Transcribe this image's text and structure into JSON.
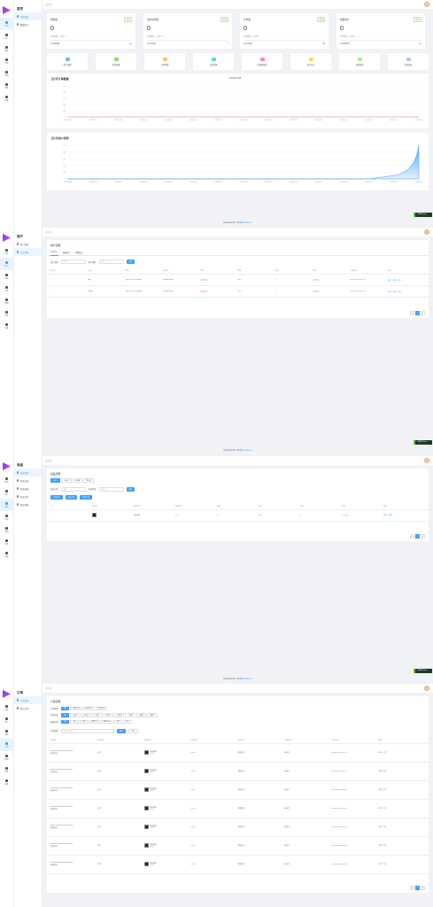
{
  "breadcrumb": "工作台",
  "user": {
    "name": "admin"
  },
  "footer": {
    "prefix": "Powered By ",
    "link": "CRMEB Java 1.0"
  },
  "badge": {
    "text": "CRMEB Java"
  },
  "nav": [
    {
      "label": "首页",
      "icon": "home-icon"
    },
    {
      "label": "用户",
      "icon": "user-icon"
    },
    {
      "label": "商品",
      "icon": "goods-icon"
    },
    {
      "label": "订单",
      "icon": "order-icon"
    },
    {
      "label": "营销",
      "icon": "marketing-icon"
    },
    {
      "label": "财务",
      "icon": "finance-icon"
    },
    {
      "label": "设置",
      "icon": "settings-icon"
    }
  ],
  "screen1": {
    "sub_title": "首页",
    "sub_items": [
      "控制面板",
      "数据统计"
    ],
    "stats": [
      {
        "title": "销售额",
        "tag": "今日",
        "value": "0",
        "sub": "昨日数据：0  本周：0",
        "foot_l": "本月销售额",
        "foot_r": "0元"
      },
      {
        "title": "用户访问量",
        "tag": "今日",
        "value": "0",
        "sub": "昨日数据：0  本周：0",
        "foot_l": "本月访问量",
        "foot_r": "0"
      },
      {
        "title": "订单量",
        "tag": "今日",
        "value": "0",
        "sub": "昨日数据：0  本周：0",
        "foot_l": "本月订单量",
        "foot_r": "0单"
      },
      {
        "title": "新增用户",
        "tag": "今日",
        "value": "0",
        "sub": "昨日数据：0  本周：0",
        "foot_l": "本月新增用户",
        "foot_r": "0人"
      }
    ],
    "quick": [
      {
        "label": "用户管理",
        "color": "#69c0ff"
      },
      {
        "label": "商品管理",
        "color": "#95de64"
      },
      {
        "label": "订单管理",
        "color": "#ffc069"
      },
      {
        "label": "分类管理",
        "color": "#5cdbd3"
      },
      {
        "label": "优惠券管理",
        "color": "#ff85c0"
      },
      {
        "label": "积分日志",
        "color": "#ffd666"
      },
      {
        "label": "提现管理",
        "color": "#b7eb8f"
      },
      {
        "label": "系统设置",
        "color": "#adc6ff"
      }
    ],
    "chart1_title": "近7天订单数据",
    "chart1_legend": "订单金额  订单数",
    "chart2_title": "近7天用户走势"
  },
  "chart_data": [
    {
      "type": "line",
      "title": "近7天订单数据",
      "x": [
        "2022-05-01",
        "2022-05-02",
        "2022-05-03",
        "2022-05-04",
        "2022-05-05",
        "2022-05-06",
        "2022-05-07",
        "2022-05-08",
        "2022-05-09",
        "2022-05-10",
        "2022-05-11",
        "2022-05-12",
        "2022-05-13",
        "2022-05-14",
        "2022-05-15"
      ],
      "series": [
        {
          "name": "订单金额",
          "values": [
            0,
            0,
            0,
            0,
            0,
            0,
            0,
            0,
            0,
            0,
            0,
            0,
            0,
            0,
            0
          ]
        }
      ],
      "yticks": [
        "1.0",
        "0.8",
        "0.6",
        "0.4",
        "0.2",
        "0"
      ],
      "ylim": [
        0,
        1
      ]
    },
    {
      "type": "area",
      "title": "近7天用户走势",
      "x": [
        "2022-05-01",
        "2022-05-02",
        "2022-05-03",
        "2022-05-04",
        "2022-05-05",
        "2022-05-06",
        "2022-05-07",
        "2022-05-08",
        "2022-05-09",
        "2022-05-10",
        "2022-05-11",
        "2022-05-12",
        "2022-05-13",
        "2022-05-14",
        "2022-05-15"
      ],
      "series": [
        {
          "name": "",
          "values": [
            0,
            0,
            0,
            0,
            0,
            0,
            0,
            0,
            0,
            0,
            0,
            0,
            0,
            0.1,
            1
          ]
        }
      ],
      "yticks": [
        "1.0",
        "0.8",
        "0.6",
        "0.4",
        "0.2",
        "0"
      ],
      "ylim": [
        0,
        1
      ]
    }
  ],
  "screen2": {
    "sub_title": "用户",
    "sub_items": [
      "用户管理",
      "会员等级"
    ],
    "panel_title": "用户管理",
    "tabs": [
      "全部用户",
      "普通用户",
      "付费会员"
    ],
    "filter_label": "用户名称",
    "filter_ph": "请输入",
    "filter_label2": "用户昵称",
    "search_btn": "搜索",
    "columns": [
      "用户ID",
      "头像",
      "昵称",
      "手机号",
      "性别",
      "余额",
      "积分",
      "状态",
      "注册时间",
      "操作"
    ],
    "rows": [
      [
        "1",
        "tpm",
        "http://127.0.0.1/avatar",
        "13800000000",
        "未知",
        "0.00",
        "0",
        "正常",
        "2022-05-12 10:22:32"
      ],
      [
        "2",
        "crmeb",
        "http://127.0.0.1/avatar",
        "13900000000",
        "未知",
        "0.00",
        "0",
        "正常",
        "2022-05-12 10:22:32"
      ]
    ],
    "actions": [
      "编辑",
      "详情",
      "更多"
    ]
  },
  "screen3": {
    "sub_title": "商品",
    "sub_items": [
      "商品管理",
      "商品分类",
      "商品规格",
      "商品评论",
      "商品参数"
    ],
    "panel_title": "商品管理",
    "tabs": [
      "出售中",
      "仓库中",
      "已售罄",
      "回收站"
    ],
    "filter_label": "商品分类",
    "filter_label2": "商品名称",
    "filter_ph": "请输入",
    "search_btn": "搜索",
    "btns": [
      "添加商品",
      "批量上架",
      "批量下架"
    ],
    "columns": [
      "ID",
      "商品图",
      "商品名称",
      "商品售价",
      "销量",
      "库存",
      "排序",
      "状态",
      "操作"
    ],
    "row": [
      "1",
      "",
      "测试商品",
      "0.01",
      "0",
      "999",
      "0",
      "上架"
    ],
    "actions": [
      "编辑",
      "删除"
    ]
  },
  "screen4": {
    "sub_title": "订单",
    "sub_items": [
      "订单管理",
      "售后订单"
    ],
    "panel_title": "订单管理",
    "filter_rows": [
      {
        "label": "订单类型",
        "chips": [
          "全部",
          "普通订单",
          "拼团订单",
          "秒杀订单"
        ]
      },
      {
        "label": "订单状态",
        "chips": [
          "全部",
          "未支付",
          "未发货",
          "待收货",
          "待评价",
          "已完成",
          "已退款",
          "已删除",
          "退款中"
        ]
      },
      {
        "label": "创建时间",
        "chips": [
          "全部",
          "今天",
          "昨天",
          "最近7天",
          "最近30天",
          "本月",
          "本年"
        ]
      }
    ],
    "search_label": "订单搜索",
    "search_ph": "请输入订单号",
    "search_btn": "搜索",
    "export_btn": "导出",
    "columns": [
      "订单号",
      "用户信息",
      "商品信息",
      "实际支付",
      "支付方式",
      "订单状态",
      "下单时间",
      "操作"
    ],
    "rows": [
      {
        "no": "802918930592001234567890",
        "type": "普通订单",
        "user": "小明",
        "goods": "测试商品",
        "price": "¥0.01",
        "pay": "微信支付",
        "status": "未支付",
        "time": "2022-05-12 10:22:32"
      },
      {
        "no": "802918930592001234567891",
        "type": "普通订单",
        "user": "小明",
        "goods": "测试商品",
        "price": "¥0.01",
        "pay": "微信支付",
        "status": "未支付",
        "time": "2022-05-12 10:20:11"
      },
      {
        "no": "802918930592001234567892",
        "type": "普通订单",
        "user": "小明",
        "goods": "测试商品",
        "price": "¥0.01",
        "pay": "微信支付",
        "status": "未支付",
        "time": "2022-05-12 10:18:45"
      },
      {
        "no": "802918930592001234567893",
        "type": "普通订单",
        "user": "小明",
        "goods": "测试商品",
        "price": "¥0.01",
        "pay": "微信支付",
        "status": "未支付",
        "time": "2022-05-12 10:15:02"
      },
      {
        "no": "802918930592001234567894",
        "type": "普通订单",
        "user": "小明",
        "goods": "测试商品",
        "price": "¥0.01",
        "pay": "微信支付",
        "status": "未支付",
        "time": "2022-05-12 10:12:30"
      },
      {
        "no": "802918930592001234567895",
        "type": "普通订单",
        "user": "小明",
        "goods": "测试商品",
        "price": "¥0.01",
        "pay": "微信支付",
        "status": "未支付",
        "time": "2022-05-12 10:10:09"
      },
      {
        "no": "802918930592001234567896",
        "type": "普通订单",
        "user": "小明",
        "goods": "测试商品",
        "price": "¥0.01",
        "pay": "微信支付",
        "status": "未支付",
        "time": "2022-05-12 10:05:47"
      }
    ],
    "actions": [
      "详情",
      "更多"
    ]
  },
  "pager": [
    "<",
    "1",
    ">"
  ]
}
